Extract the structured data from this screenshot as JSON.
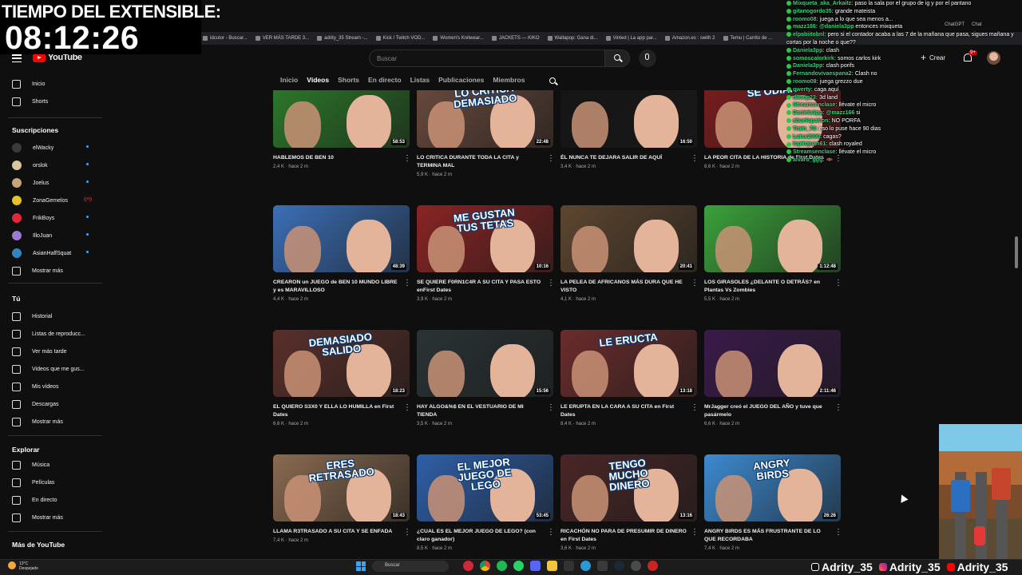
{
  "overlay": {
    "timer_label": "TIEMPO DEL EXTENSIBLE:",
    "timer_value": "08:12:26"
  },
  "bookmarks": [
    "idcutor - Buscar...",
    "VER MÁS TARDE 3...",
    "adrity_35 Stream -...",
    "Kick / Twitch VOD...",
    "Women's Knitwear...",
    "JACKETS — KIKO",
    "Wallapop: Gana di...",
    "Vinted | La app par...",
    "Amazon.es : swith 2",
    "Temu | Carrito de ..."
  ],
  "masthead": {
    "logo": "YouTube",
    "search_placeholder": "Buscar",
    "create_label": "Crear",
    "notif_count": "9+"
  },
  "sidebar": {
    "main": [
      {
        "label": "Inicio",
        "icon": "home-icon"
      },
      {
        "label": "Shorts",
        "icon": "shorts-icon"
      }
    ],
    "subs_header": "Suscripciones",
    "subs": [
      {
        "label": "elWacky",
        "color": "#3a3a3a",
        "live": false
      },
      {
        "label": "orslok",
        "color": "#d9c7a0",
        "live": false
      },
      {
        "label": "Joelus",
        "color": "#c9a37a",
        "live": false
      },
      {
        "label": "ZonaGemelos",
        "color": "#e6c229",
        "live": true
      },
      {
        "label": "FrikBoys",
        "color": "#e8263a",
        "live": false
      },
      {
        "label": "IlloJuan",
        "color": "#9b7ad1",
        "live": false
      },
      {
        "label": "AsianHalfSquat",
        "color": "#2e86c1",
        "live": false
      }
    ],
    "subs_more": "Mostrar más",
    "you_header": "Tú",
    "you_items": [
      {
        "label": "Historial",
        "icon": "history-icon"
      },
      {
        "label": "Listas de reproducc...",
        "icon": "playlist-icon"
      },
      {
        "label": "Ver más tarde",
        "icon": "watch-later-icon"
      },
      {
        "label": "Videos que me gus...",
        "icon": "like-icon"
      },
      {
        "label": "Mis vídeos",
        "icon": "my-videos-icon"
      },
      {
        "label": "Descargas",
        "icon": "download-icon"
      }
    ],
    "you_more": "Mostrar más",
    "explore_header": "Explorar",
    "explore_items": [
      {
        "label": "Música",
        "icon": "music-icon"
      },
      {
        "label": "Películas",
        "icon": "movies-icon"
      },
      {
        "label": "En directo",
        "icon": "live-icon"
      }
    ],
    "explore_more": "Mostrar más",
    "more_header": "Más de YouTube"
  },
  "tabs": [
    "Inicio",
    "Vídeos",
    "Shorts",
    "En directo",
    "Listas",
    "Publicaciones",
    "Miembros"
  ],
  "active_tab": "Vídeos",
  "videos": [
    {
      "title": "HABLEMOS DE BEN 10",
      "meta": "2,4 K · hace 2 m",
      "duration": "58:53",
      "caption": "",
      "bg": "#2c7a2a"
    },
    {
      "title": "LO CRITICA DURANTE TODA LA CITA y TERMINA MAL",
      "meta": "5,9 K · hace 2 m",
      "duration": "22:48",
      "caption": "LO CRITICA DEMASIADO",
      "bg": "#6a4a3d"
    },
    {
      "title": "ÉL NUNCA TE DEJARA SALIR DE AQUÍ",
      "meta": "3,4 K · hace 2 m",
      "duration": "16:50",
      "caption": "",
      "bg": "#151515"
    },
    {
      "title": "LA PEOR CITA DE LA HISTORIA de First Dates",
      "meta": "8,6 K · hace 2 m",
      "duration": "",
      "caption": "SE ODIAN",
      "bg": "#7a1d1d"
    },
    {
      "title": "CREARON un JUEGO de BEN 10 MUNDO LIBRE y es MARAVILLOSO",
      "meta": "4,4 K · hace 2 m",
      "duration": "48:39",
      "caption": "",
      "bg": "#3b6fb6"
    },
    {
      "title": "SE QUIERE F0RN1C4R A SU CITA Y PASA ESTO enFirst Dates",
      "meta": "3,9 K · hace 2 m",
      "duration": "10:16",
      "caption": "ME GUSTAN TUS TETAS",
      "bg": "#8a2424"
    },
    {
      "title": "LA PELEA DE AFRICANOS MÁS DURA QUE HE VISTO",
      "meta": "4,1 K · hace 2 m",
      "duration": "20:41",
      "caption": "",
      "bg": "#5d4630"
    },
    {
      "title": "LOS GIRASOLES ¿DELANTE O DETRÁS? en Plantas Vs Zombies",
      "meta": "5,5 K · hace 2 m",
      "duration": "1:12:48",
      "caption": "",
      "bg": "#3aa13a"
    },
    {
      "title": "EL QUIERO S3X0 Y ELLA LO HUMILLA en First Dates",
      "meta": "6,6 K · hace 2 m",
      "duration": "18:23",
      "caption": "DEMASIADO SALIDO",
      "bg": "#5a2f2a"
    },
    {
      "title": "HAY ALGO&%$ EN EL VESTUARIO DE MI TIENDA",
      "meta": "3,5 K · hace 2 m",
      "duration": "15:56",
      "caption": "",
      "bg": "#2a3335"
    },
    {
      "title": "LE ERUPTA EN LA CARA A SU CITA en First Dates",
      "meta": "8,4 K · hace 2 m",
      "duration": "13:18",
      "caption": "LE ERUCTA",
      "bg": "#6b2c2c"
    },
    {
      "title": "MrJagger creó el JUEGO DEL AÑO y tuve que pasármelo",
      "meta": "6,6 K · hace 2 m",
      "duration": "2:11:46",
      "caption": "",
      "bg": "#3a1a4a"
    },
    {
      "title": "LLAMA R3TRASADO A SU CITA Y SE ENFADA",
      "meta": "7,4 K · hace 2 m",
      "duration": "18:43",
      "caption": "ERES RETRASADO",
      "bg": "#8a6a50"
    },
    {
      "title": "¿CUAL ES EL MEJOR JUEGO DE LEGO? (con claro ganador)",
      "meta": "8,5 K · hace 2 m",
      "duration": "53:45",
      "caption": "EL MEJOR JUEGO DE LEGO",
      "bg": "#2f5fa8"
    },
    {
      "title": "RICACHÓN NO PARA DE PRESUMIR DE DINERO en First Dates",
      "meta": "3,6 K · hace 2 m",
      "duration": "13:16",
      "caption": "TENGO MUCHO DINERO",
      "bg": "#4a2626"
    },
    {
      "title": "ANGRY BIRDS ES MÁS FRUSTRANTE DE LO QUE RECORDABA",
      "meta": "7,4 K · hace 2 m",
      "duration": "26:26",
      "caption": "ANGRY BIRDS",
      "bg": "#3c8ad0"
    }
  ],
  "chat": [
    {
      "user": "Mixqueta_aka_Arkaitz:",
      "text": "paso la sala por el grupo de ig y por el pantano"
    },
    {
      "user": "gitanogordo35:",
      "text": "grande mateista"
    },
    {
      "user": "roomo08:",
      "text": "juega a lo que sea menos a..."
    },
    {
      "user": "mazz166: @daniela3pp",
      "text": "entonces mixqueta"
    },
    {
      "user": "elpabiitobnl:",
      "text": "pero si el contador acaba a las 7 de la mañana que pasa, sigues mañana y cortas por la noche o que??"
    },
    {
      "user": "Daniela3pp:",
      "text": "clash"
    },
    {
      "user": "somoscalorkirk:",
      "text": "somos carlos kirk"
    },
    {
      "user": "Daniela3pp:",
      "text": "clash porifs"
    },
    {
      "user": "Fernandovivaespana2:",
      "text": "Clash no"
    },
    {
      "user": "roomo08:",
      "text": "juega grezzo due"
    },
    {
      "user": "qwerty:",
      "text": "caga aquí"
    },
    {
      "user": "dlloop23:",
      "text": "3d land"
    },
    {
      "user": "Streamsenclase:",
      "text": "llévate el micro"
    },
    {
      "user": "Daniela3pp: @mazz166",
      "text": "si"
    },
    {
      "user": "abuelopatron:",
      "text": "NO PORFA"
    },
    {
      "user": "Train_70:",
      "text": "eso lo puse hace 90 dias"
    },
    {
      "user": "Luisx2000:",
      "text": "cagas?"
    },
    {
      "user": "lopitojuan61:",
      "text": "clash royaled"
    },
    {
      "user": "Streamsenclase:",
      "text": "llévate el micro"
    },
    {
      "user": "alvaro_ggg:",
      "text": "🦇"
    }
  ],
  "browser_ext": [
    "ChatGPT",
    "Chat"
  ],
  "socials": [
    "Adrity_35",
    "Adrity_35",
    "Adrity_35"
  ],
  "taskbar": {
    "weather_temp": "13°C",
    "weather_desc": "Despejado",
    "search_label": "Buscar"
  }
}
